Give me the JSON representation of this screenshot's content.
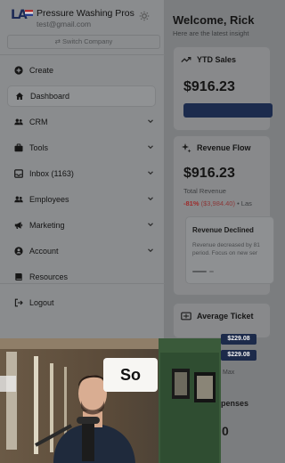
{
  "brand": {
    "logo_text": "LA",
    "name": "Pressure Washing Pros",
    "email": "test@gmail.com",
    "switch_company": "⇄ Switch Company"
  },
  "sidebar": {
    "items": [
      {
        "label": "Create",
        "icon": "plus-circle-icon"
      },
      {
        "label": "Dashboard",
        "icon": "home-icon",
        "active": true
      },
      {
        "label": "CRM",
        "icon": "users-icon",
        "has_children": true
      },
      {
        "label": "Tools",
        "icon": "briefcase-icon",
        "has_children": true
      },
      {
        "label": "Inbox (1163)",
        "icon": "inbox-icon",
        "has_children": true
      },
      {
        "label": "Employees",
        "icon": "users-icon",
        "has_children": true
      },
      {
        "label": "Marketing",
        "icon": "megaphone-icon",
        "has_children": true
      },
      {
        "label": "Account",
        "icon": "account-icon",
        "has_children": true
      },
      {
        "label": "Resources",
        "icon": "book-icon"
      },
      {
        "label": "Logout",
        "icon": "logout-icon"
      }
    ]
  },
  "main": {
    "welcome": "Welcome, Rick",
    "subtitle": "Here are the latest insight",
    "ytd": {
      "title": "YTD Sales",
      "value": "$916.23"
    },
    "revenue_flow": {
      "title": "Revenue Flow",
      "value": "$916.23",
      "label": "Total Revenue",
      "change_pct": "-81%",
      "change_amt": "($3,984.40)",
      "change_suffix": "• Las",
      "alert_title": "Revenue Declined",
      "alert_text_1": "Revenue decreased by 81",
      "alert_text_2": "period. Focus on new ser"
    },
    "average_ticket": {
      "title": "Average Ticket"
    },
    "badges": [
      "$229.08",
      "$229.08"
    ],
    "badge_caption": "Max",
    "expenses_title": "penses",
    "expenses_value": "0"
  },
  "video": {
    "caption": "So"
  },
  "colors": {
    "accent": "#1c2b4d",
    "negative": "#9e2b2b"
  }
}
